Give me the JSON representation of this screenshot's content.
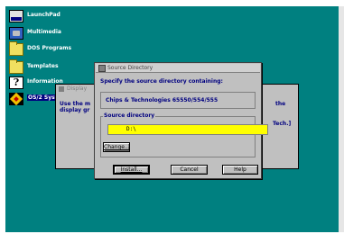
{
  "desktop": {
    "icons": [
      {
        "label": "LaunchPad",
        "icon": "launchpad-icon"
      },
      {
        "label": "Multimedia",
        "icon": "multimedia-icon"
      },
      {
        "label": "DOS Programs",
        "icon": "folder-icon"
      },
      {
        "label": "Templates",
        "icon": "templates-icon"
      },
      {
        "label": "Information",
        "icon": "information-icon"
      },
      {
        "label": "OS/2 Syste",
        "icon": "os2-system-icon"
      }
    ]
  },
  "display_dialog": {
    "title": "Display",
    "text_left_1": "Use the m",
    "text_left_2": "display gr",
    "text_right_1": "the",
    "text_right_2": "Tech.]"
  },
  "source_dialog": {
    "title": "Source Directory",
    "prompt": "Specify the source directory containing:",
    "chipset": "Chips & Technologies 65550/554/555",
    "group_label": "Source directory",
    "directory_value": "D:\\",
    "change_label": "Change...",
    "install_label": "Install...",
    "cancel_label": "Cancel",
    "help_label": "Help"
  },
  "colors": {
    "desktop": "#008080",
    "dialog": "#c0c0c0",
    "text_accent": "#000080",
    "input_highlight": "#ffff00"
  }
}
